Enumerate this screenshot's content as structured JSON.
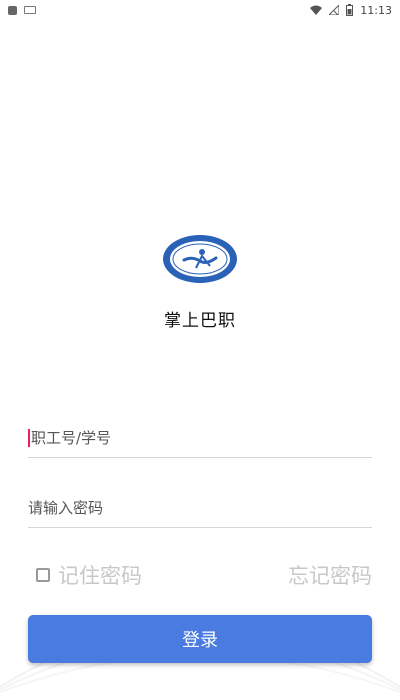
{
  "status_bar": {
    "time": "11:13",
    "icons": [
      "app-notification-icon",
      "keyboard-icon",
      "wifi-icon",
      "no-signal-icon",
      "battery-icon"
    ]
  },
  "logo": {
    "emblem_icon": "college-emblem-icon",
    "colors": {
      "ring": "#2a62b8",
      "inner": "#ffffff"
    }
  },
  "app": {
    "name": "掌上巴职"
  },
  "login_form": {
    "username_placeholder": "职工号/学号",
    "password_placeholder": "请输入密码",
    "remember_label": "记住密码",
    "forgot_label": "忘记密码",
    "login_label": "登录"
  },
  "colors": {
    "accent": "#4a7be0",
    "cursor": "#e91e63",
    "muted_text": "#c8c8c8"
  }
}
